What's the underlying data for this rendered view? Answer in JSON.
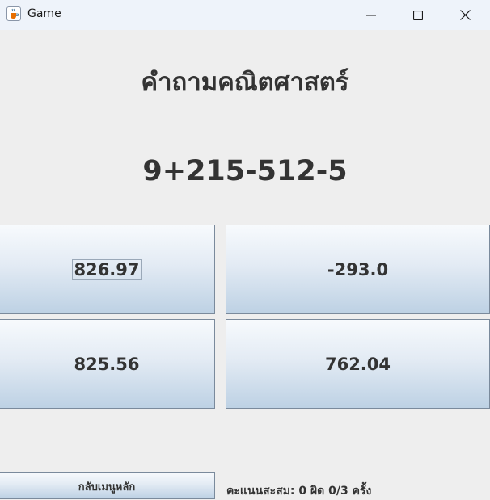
{
  "window": {
    "title": "Game",
    "icon": "java-cup-icon"
  },
  "heading": "คำถามคณิตศาสตร์",
  "question": "9+215-512-5",
  "answers": [
    "826.97",
    "-293.0",
    "825.56",
    "762.04"
  ],
  "back_button": "กลับเมนูหลัก",
  "score": "คะแนนสะสม: 0 ผิด 0/3 ครั้ง"
}
